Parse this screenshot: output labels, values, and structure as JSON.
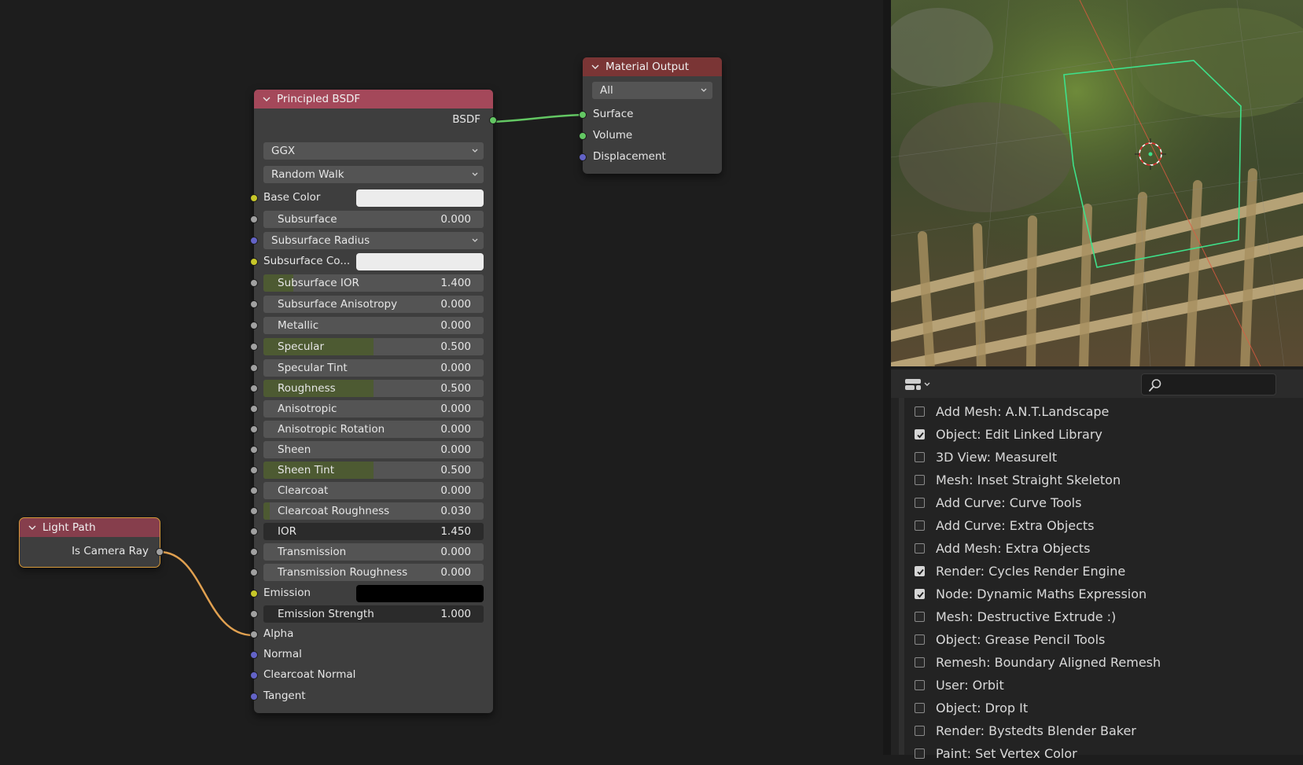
{
  "nodes": {
    "principled": {
      "title": "Principled BSDF",
      "output_label": "BSDF",
      "distribution": "GGX",
      "subsurface_method": "Random Walk",
      "inputs": {
        "base_color": "Base Color",
        "subsurface": {
          "label": "Subsurface",
          "value": "0.000"
        },
        "subsurface_radius": "Subsurface Radius",
        "subsurface_color": "Subsurface Co...",
        "subsurface_ior": {
          "label": "Subsurface IOR",
          "value": "1.400"
        },
        "subsurface_anisotropy": {
          "label": "Subsurface Anisotropy",
          "value": "0.000"
        },
        "metallic": {
          "label": "Metallic",
          "value": "0.000"
        },
        "specular": {
          "label": "Specular",
          "value": "0.500"
        },
        "specular_tint": {
          "label": "Specular Tint",
          "value": "0.000"
        },
        "roughness": {
          "label": "Roughness",
          "value": "0.500"
        },
        "anisotropic": {
          "label": "Anisotropic",
          "value": "0.000"
        },
        "anisotropic_rotation": {
          "label": "Anisotropic Rotation",
          "value": "0.000"
        },
        "sheen": {
          "label": "Sheen",
          "value": "0.000"
        },
        "sheen_tint": {
          "label": "Sheen Tint",
          "value": "0.500"
        },
        "clearcoat": {
          "label": "Clearcoat",
          "value": "0.000"
        },
        "clearcoat_roughness": {
          "label": "Clearcoat Roughness",
          "value": "0.030"
        },
        "ior": {
          "label": "IOR",
          "value": "1.450"
        },
        "transmission": {
          "label": "Transmission",
          "value": "0.000"
        },
        "transmission_roughness": {
          "label": "Transmission Roughness",
          "value": "0.000"
        },
        "emission": "Emission",
        "emission_strength": {
          "label": "Emission Strength",
          "value": "1.000"
        },
        "alpha": "Alpha",
        "normal": "Normal",
        "clearcoat_normal": "Clearcoat Normal",
        "tangent": "Tangent"
      },
      "colors": {
        "base_color": "#ececec",
        "subsurface_color": "#ececec",
        "emission": "#000000"
      }
    },
    "material_output": {
      "title": "Material Output",
      "target": "All",
      "surface": "Surface",
      "volume": "Volume",
      "displacement": "Displacement"
    },
    "light_path": {
      "title": "Light Path",
      "output": "Is Camera Ray"
    }
  },
  "addons": {
    "search_placeholder": "",
    "items": [
      {
        "name": "Add Mesh: A.N.T.Landscape",
        "enabled": false
      },
      {
        "name": "Object: Edit Linked Library",
        "enabled": true
      },
      {
        "name": "3D View: MeasureIt",
        "enabled": false
      },
      {
        "name": "Mesh: Inset Straight Skeleton",
        "enabled": false
      },
      {
        "name": "Add Curve: Curve Tools",
        "enabled": false
      },
      {
        "name": "Add Curve: Extra Objects",
        "enabled": false
      },
      {
        "name": "Add Mesh: Extra Objects",
        "enabled": false
      },
      {
        "name": "Render: Cycles Render Engine",
        "enabled": true
      },
      {
        "name": "Node: Dynamic Maths Expression",
        "enabled": true
      },
      {
        "name": "Mesh: Destructive Extrude :)",
        "enabled": false
      },
      {
        "name": "Object: Grease Pencil Tools",
        "enabled": false
      },
      {
        "name": "Remesh: Boundary Aligned Remesh",
        "enabled": false
      },
      {
        "name": "User: Orbit",
        "enabled": false
      },
      {
        "name": "Object: Drop It",
        "enabled": false
      },
      {
        "name": "Render: Bystedts Blender Baker",
        "enabled": false
      },
      {
        "name": "Paint: Set Vertex Color",
        "enabled": false
      }
    ]
  },
  "icons": {
    "collapse": "chevron-down-icon",
    "search": "search-icon",
    "editor_type": "editor-type-icon",
    "checkbox": "checkmark-icon"
  },
  "theme": {
    "shader_header": "#a4485a",
    "output_header": "#7a3535",
    "link_green": "#63c763",
    "link_orange": "#e0a050"
  }
}
